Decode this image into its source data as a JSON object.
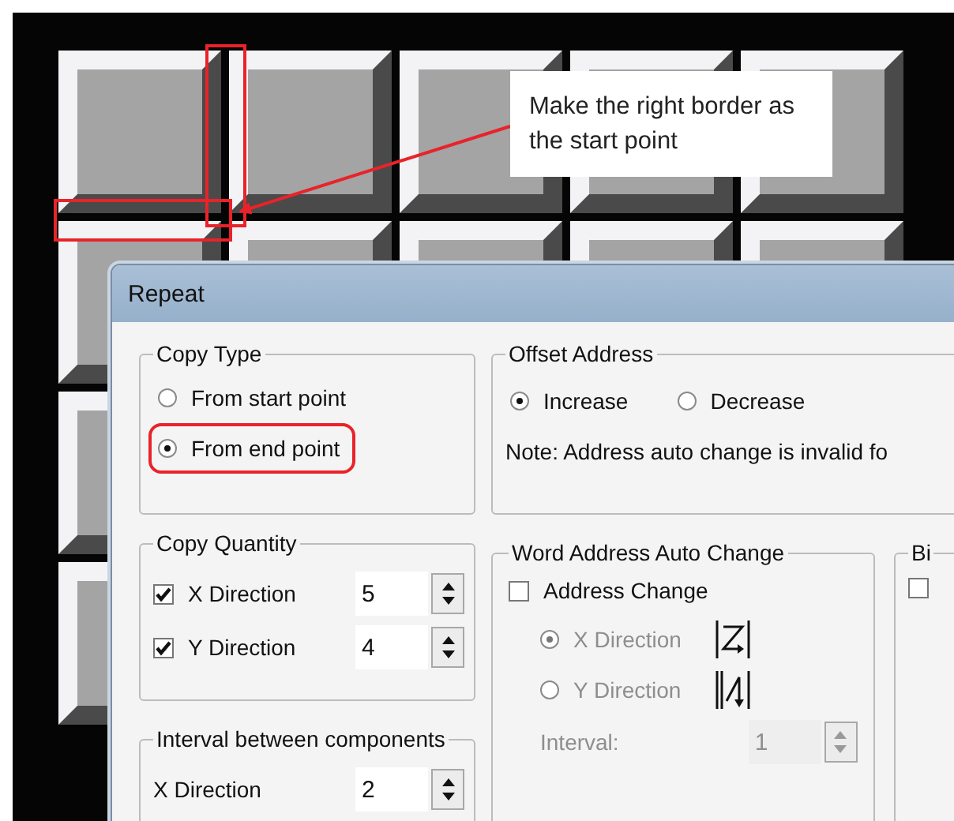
{
  "annotation": {
    "callout": "Make the right border as the start point"
  },
  "dialog": {
    "title": "Repeat",
    "copy_type": {
      "label": "Copy Type",
      "options": [
        {
          "label": "From start point",
          "selected": false,
          "highlighted": false
        },
        {
          "label": "From end point",
          "selected": true,
          "highlighted": true
        }
      ]
    },
    "offset_address": {
      "label": "Offset Address",
      "options": [
        {
          "label": "Increase",
          "selected": true
        },
        {
          "label": "Decrease",
          "selected": false
        }
      ],
      "note": "Note: Address auto change is invalid fo"
    },
    "copy_quantity": {
      "label": "Copy Quantity",
      "rows": [
        {
          "label": "X Direction",
          "checked": true,
          "value": "5"
        },
        {
          "label": "Y Direction",
          "checked": true,
          "value": "4"
        }
      ]
    },
    "interval": {
      "label": "Interval between components",
      "rows": [
        {
          "label": "X Direction",
          "value": "2"
        }
      ]
    },
    "word_address": {
      "label": "Word Address Auto Change",
      "checkbox": {
        "label": "Address Change",
        "checked": false
      },
      "options": [
        {
          "label": "X Direction",
          "selected": true,
          "disabled": true,
          "kind": "z"
        },
        {
          "label": "Y Direction",
          "selected": false,
          "disabled": true,
          "kind": "n"
        }
      ],
      "interval": {
        "label": "Interval:",
        "value": "1",
        "disabled": true
      }
    },
    "bit_group": {
      "label": "Bi",
      "checkbox": {
        "checked": false
      }
    }
  }
}
